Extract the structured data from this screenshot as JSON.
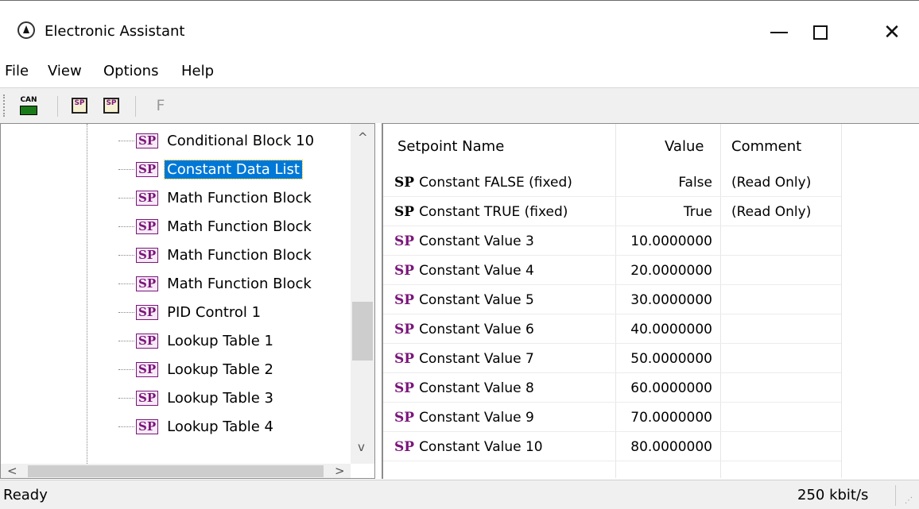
{
  "window": {
    "title": "Electronic Assistant",
    "min_glyph": "",
    "max_glyph": "",
    "close_glyph": "✕"
  },
  "menu": [
    "File",
    "View",
    "Options",
    "Help"
  ],
  "toolbar": {
    "buttons": [
      "can-connect-icon",
      "open-setpoint-file-icon",
      "save-setpoint-file-icon",
      "flash-icon"
    ],
    "flash_label": "F"
  },
  "tree": {
    "items": [
      {
        "icon": "SP",
        "label": "Conditional Block 10",
        "selected": false
      },
      {
        "icon": "SP",
        "label": "Constant Data List",
        "selected": true
      },
      {
        "icon": "SP",
        "label": "Math Function Block",
        "selected": false
      },
      {
        "icon": "SP",
        "label": "Math Function Block",
        "selected": false
      },
      {
        "icon": "SP",
        "label": "Math Function Block",
        "selected": false
      },
      {
        "icon": "SP",
        "label": "Math Function Block",
        "selected": false
      },
      {
        "icon": "SP",
        "label": "PID Control 1",
        "selected": false
      },
      {
        "icon": "SP",
        "label": "Lookup Table 1",
        "selected": false
      },
      {
        "icon": "SP",
        "label": "Lookup Table 2",
        "selected": false
      },
      {
        "icon": "SP",
        "label": "Lookup Table 3",
        "selected": false
      },
      {
        "icon": "SP",
        "label": "Lookup Table 4",
        "selected": false
      }
    ],
    "scroll_up": "^",
    "scroll_down": "v",
    "scroll_left": "<",
    "scroll_right": ">"
  },
  "table": {
    "headers": [
      "Setpoint Name",
      "Value",
      "Comment"
    ],
    "rows": [
      {
        "sp_color": "black",
        "sp": "SP",
        "name": "Constant FALSE (fixed)",
        "value": "False",
        "comment": "(Read Only)"
      },
      {
        "sp_color": "black",
        "sp": "SP",
        "name": "Constant TRUE (fixed)",
        "value": "True",
        "comment": "(Read Only)"
      },
      {
        "sp_color": "purple",
        "sp": "SP",
        "name": "Constant Value 3",
        "value": "10.0000000",
        "comment": ""
      },
      {
        "sp_color": "purple",
        "sp": "SP",
        "name": "Constant Value 4",
        "value": "20.0000000",
        "comment": ""
      },
      {
        "sp_color": "purple",
        "sp": "SP",
        "name": "Constant Value 5",
        "value": "30.0000000",
        "comment": ""
      },
      {
        "sp_color": "purple",
        "sp": "SP",
        "name": "Constant Value 6",
        "value": "40.0000000",
        "comment": ""
      },
      {
        "sp_color": "purple",
        "sp": "SP",
        "name": "Constant Value 7",
        "value": "50.0000000",
        "comment": ""
      },
      {
        "sp_color": "purple",
        "sp": "SP",
        "name": "Constant Value 8",
        "value": "60.0000000",
        "comment": ""
      },
      {
        "sp_color": "purple",
        "sp": "SP",
        "name": "Constant Value 9",
        "value": "70.0000000",
        "comment": ""
      },
      {
        "sp_color": "purple",
        "sp": "SP",
        "name": "Constant Value 10",
        "value": "80.0000000",
        "comment": ""
      }
    ]
  },
  "status": {
    "text": "Ready",
    "rate": "250 kbit/s"
  },
  "colors": {
    "selection": "#0078d7",
    "sp_purple": "#7a157a"
  }
}
